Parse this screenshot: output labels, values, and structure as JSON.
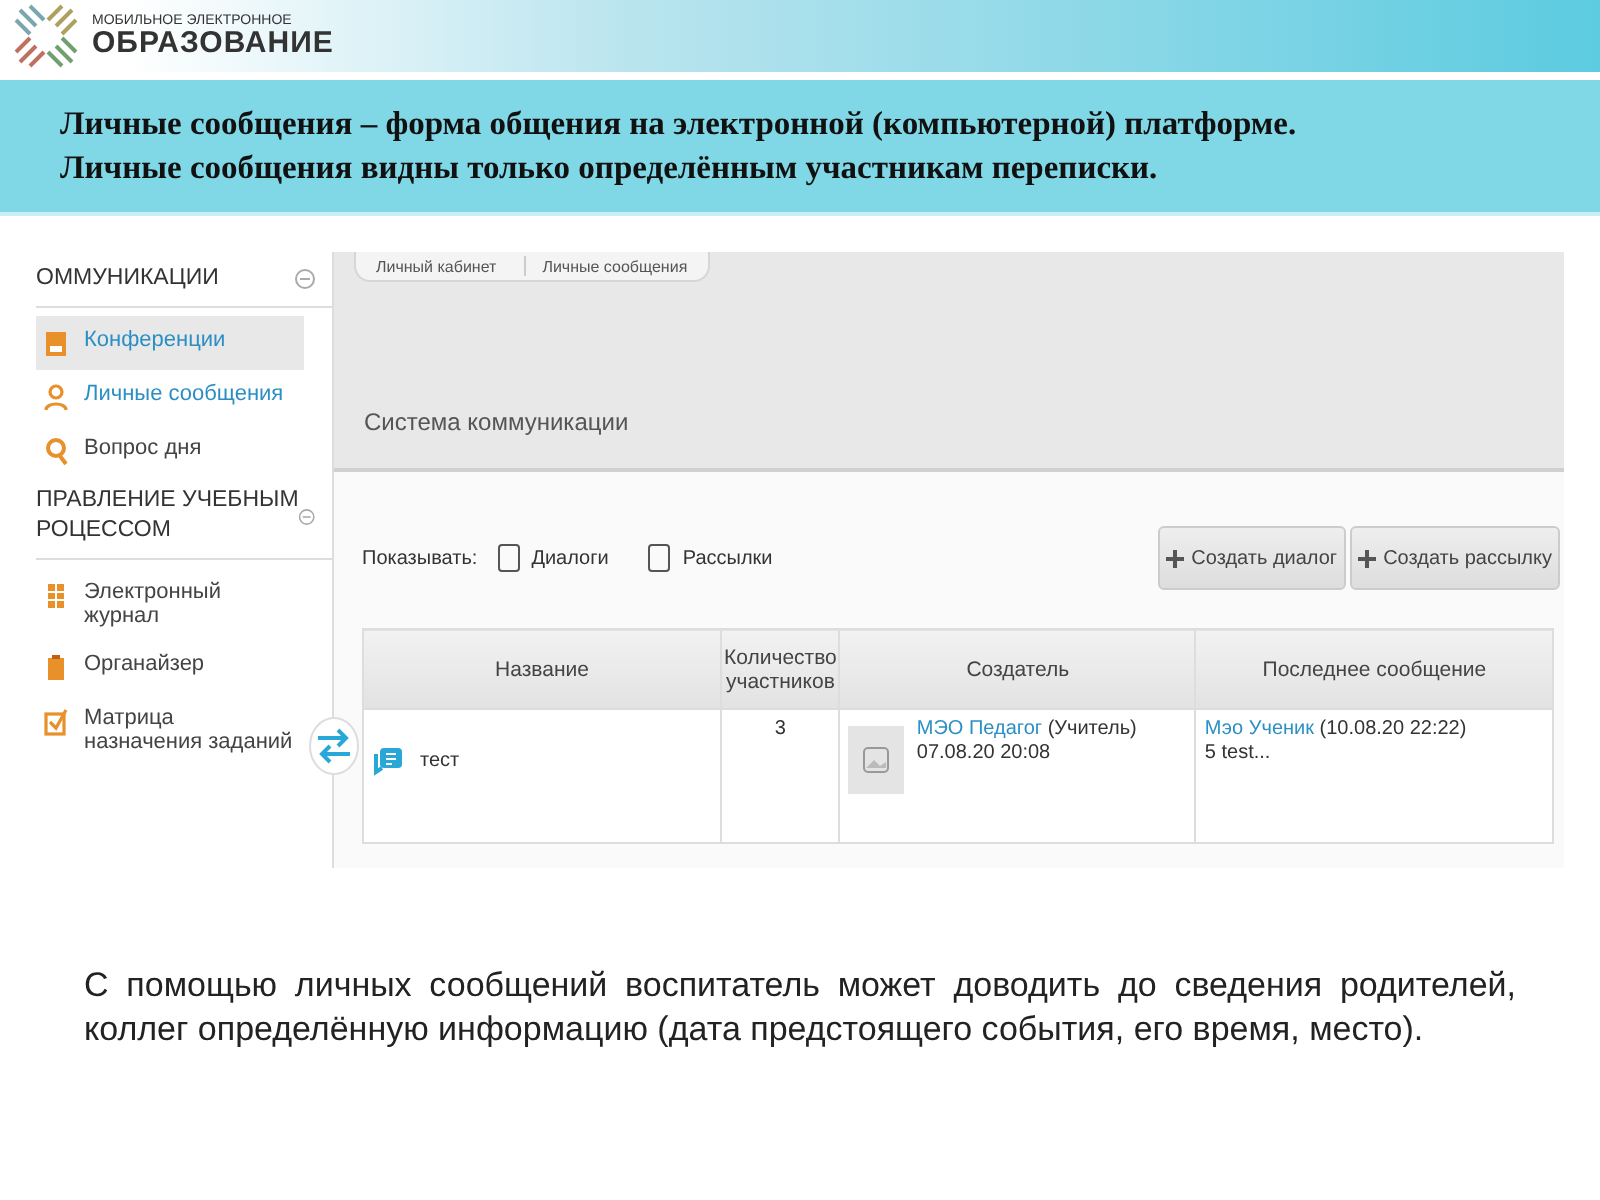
{
  "logo": {
    "small": "МОБИЛЬНОЕ ЭЛЕКТРОННОЕ",
    "big": "ОБРАЗОВАНИЕ"
  },
  "title": [
    "Личные сообщения – форма общения на электронной (компьютерной) платформе.",
    "Личные сообщения видны только определённым участникам переписки."
  ],
  "screenshot": {
    "sidebar": [
      {
        "header": [
          "ОММУНИКАЦИИ"
        ],
        "items": [
          {
            "label": "Конференции",
            "selected": true,
            "active": true
          },
          {
            "label": "Личные сообщения",
            "selected": false,
            "active": true
          },
          {
            "label": "Вопрос дня",
            "selected": false,
            "active": false
          }
        ]
      },
      {
        "header": [
          "ПРАВЛЕНИЕ УЧЕБНЫМ",
          "РОЦЕССОМ"
        ],
        "items": [
          {
            "label": "Электронный журнал",
            "selected": false,
            "active": false
          },
          {
            "label": "Органайзер",
            "selected": false,
            "active": false
          },
          {
            "label": "Матрица назначения заданий",
            "selected": false,
            "active": false
          }
        ]
      }
    ],
    "breadcrumbs": [
      "Личный кабинет",
      "Личные сообщения"
    ],
    "heading": "Система коммуникации",
    "filter_label": "Показывать:",
    "filters": [
      {
        "label": "Диалоги",
        "checked": false
      },
      {
        "label": "Рассылки",
        "checked": false
      }
    ],
    "buttons": [
      "Создать диалог",
      "Создать рассылку"
    ],
    "table": {
      "columns": [
        "Название",
        "Количество участников",
        "Создатель",
        "Последнее сообщение"
      ],
      "rows": [
        {
          "name": "тест",
          "count": "3",
          "creator": "МЭО Педагог",
          "creator_role": "(Учитель)",
          "created": "07.08.20 20:08",
          "last_author": "Мэо Ученик",
          "last_time": "(10.08.20 22:22)",
          "last_text": "5 test..."
        }
      ]
    }
  },
  "body": "С помощью личных сообщений воспитатель может доводить до сведения родителей, коллег определённую информацию (дата предстоящего события, его время, место)."
}
